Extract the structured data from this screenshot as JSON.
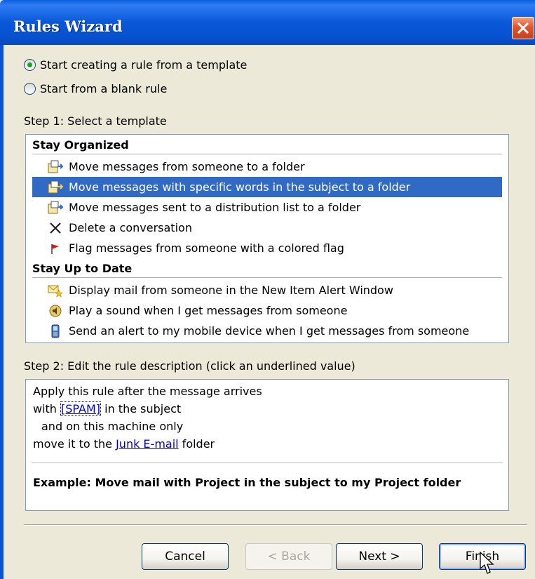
{
  "window": {
    "title": "Rules Wizard"
  },
  "options": {
    "template_label": "Start creating a rule from a template",
    "blank_label": "Start from a blank rule",
    "selected": "template"
  },
  "step1": {
    "label": "Step 1: Select a template",
    "groups": [
      {
        "header": "Stay Organized",
        "items": [
          {
            "icon": "move-folder-icon",
            "label": "Move messages from someone to a folder"
          },
          {
            "icon": "move-folder-icon",
            "label": "Move messages with specific words in the subject to a folder",
            "selected": true
          },
          {
            "icon": "move-folder-icon",
            "label": "Move messages sent to a distribution list to a folder"
          },
          {
            "icon": "delete-x-icon",
            "label": "Delete a conversation"
          },
          {
            "icon": "red-flag-icon",
            "label": "Flag messages from someone with a colored flag"
          }
        ]
      },
      {
        "header": "Stay Up to Date",
        "items": [
          {
            "icon": "alert-star-envelope-icon",
            "label": "Display mail from someone in the New Item Alert Window"
          },
          {
            "icon": "speaker-sound-icon",
            "label": "Play a sound when I get messages from someone"
          },
          {
            "icon": "mobile-phone-icon",
            "label": "Send an alert to my mobile device when I get messages from someone"
          }
        ]
      }
    ]
  },
  "step2": {
    "label": "Step 2: Edit the rule description (click an underlined value)",
    "line1": "Apply this rule after the message arrives",
    "line2_prefix": "with ",
    "line2_link": "[SPAM]",
    "line2_suffix": " in the subject",
    "line3": "and on this machine only",
    "line4_prefix": "move it to the ",
    "line4_link": "Junk E-mail",
    "line4_suffix": " folder",
    "example": "Example: Move mail with Project in the subject to my Project folder"
  },
  "buttons": {
    "cancel": "Cancel",
    "back": "< Back",
    "next": "Next >",
    "finish": "Finish"
  },
  "colors": {
    "titlebar": "#0a58d8",
    "selection": "#316ac5",
    "link": "#0000cc"
  }
}
